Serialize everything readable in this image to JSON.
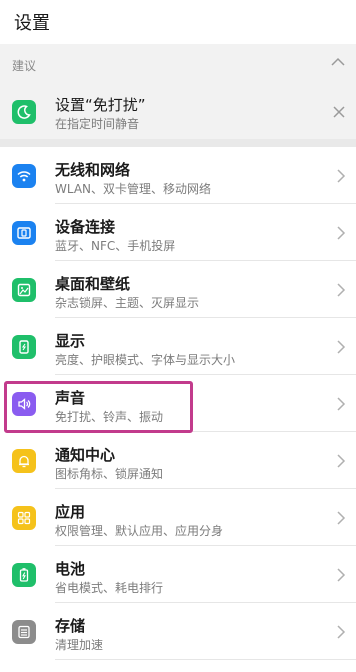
{
  "header": {
    "title": "设置"
  },
  "suggestions": {
    "heading": "建议",
    "card": {
      "title": "设置“免打扰”",
      "subtitle": "在指定时间静音",
      "icon": "moon-icon",
      "color": "#1fbf6a"
    }
  },
  "items": [
    {
      "title": "无线和网络",
      "subtitle": "WLAN、双卡管理、移动网络",
      "icon": "wifi-icon",
      "color": "#1b82f0"
    },
    {
      "title": "设备连接",
      "subtitle": "蓝牙、NFC、手机投屏",
      "icon": "device-connect-icon",
      "color": "#1b82f0"
    },
    {
      "title": "桌面和壁纸",
      "subtitle": "杂志锁屏、主题、灭屏显示",
      "icon": "wallpaper-icon",
      "color": "#1fbf6a"
    },
    {
      "title": "显示",
      "subtitle": "亮度、护眼模式、字体与显示大小",
      "icon": "display-icon",
      "color": "#1fbf6a"
    },
    {
      "title": "声音",
      "subtitle": "免打扰、铃声、振动",
      "icon": "sound-icon",
      "color": "#8a5cf0"
    },
    {
      "title": "通知中心",
      "subtitle": "图标角标、锁屏通知",
      "icon": "bell-icon",
      "color": "#f5c21b"
    },
    {
      "title": "应用",
      "subtitle": "权限管理、默认应用、应用分身",
      "icon": "apps-grid-icon",
      "color": "#f5c21b"
    },
    {
      "title": "电池",
      "subtitle": "省电模式、耗电排行",
      "icon": "battery-icon",
      "color": "#1fbf6a"
    },
    {
      "title": "存储",
      "subtitle": "清理加速",
      "icon": "storage-icon",
      "color": "#8c8c8c"
    }
  ]
}
